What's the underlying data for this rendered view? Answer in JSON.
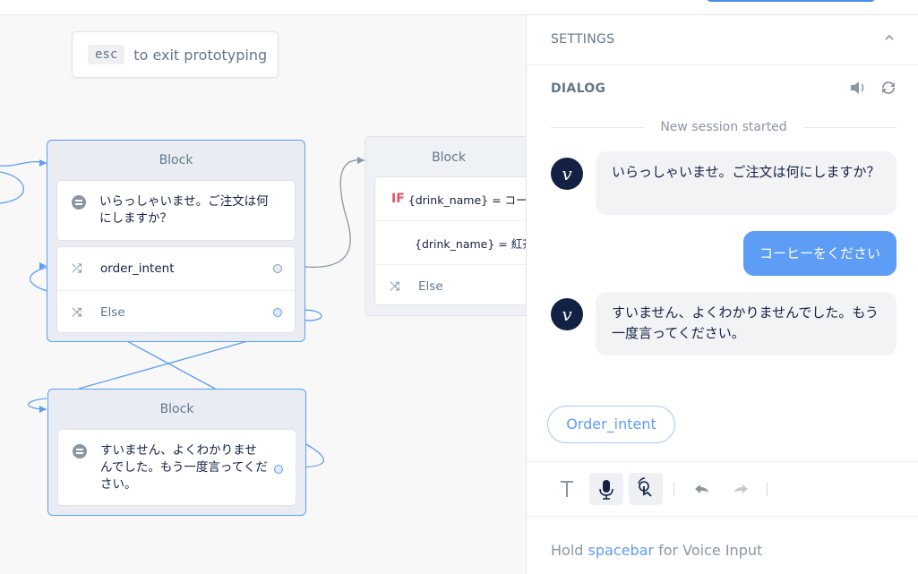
{
  "hint": {
    "key": "esc",
    "text": "to exit prototyping"
  },
  "blocks": {
    "main": {
      "title": "Block",
      "speak": "いらっしゃいませ。ご注文は何にしますか？",
      "intent_label": "order_intent",
      "else_label": "Else"
    },
    "condition": {
      "title": "Block",
      "if_label": "IF",
      "cond1": "{drink_name} = コー",
      "cond2": "{drink_name} = 紅茶",
      "else_label": "Else"
    },
    "fallback": {
      "title": "Block",
      "speak": "すいません、よくわかりませんでした。もう一度言ってください。"
    }
  },
  "panel": {
    "settings_title": "SETTINGS",
    "dialog_title": "DIALOG",
    "session_text": "New session started",
    "messages": [
      {
        "from": "bot",
        "avatar": "v",
        "text": "いらっしゃいませ。ご注文は何にしますか？"
      },
      {
        "from": "user",
        "text": "コーヒーをください"
      },
      {
        "from": "bot",
        "avatar": "v",
        "text": "すいません、よくわかりませんでした。もう一度言ってください。"
      }
    ],
    "intent_chip": "Order_intent",
    "voice_hint": {
      "prefix": "Hold ",
      "keyword": "spacebar",
      "suffix": " for Voice Input"
    }
  },
  "icons": [
    "speak-icon",
    "intent-icon",
    "else-icon",
    "sound-icon",
    "reset-icon",
    "text-icon",
    "mic-icon",
    "touch-icon",
    "undo-icon",
    "redo-icon",
    "chevron-up-icon"
  ],
  "colors": {
    "accent": "#5d9df5",
    "navy": "#132144",
    "if_red": "#e05265"
  }
}
